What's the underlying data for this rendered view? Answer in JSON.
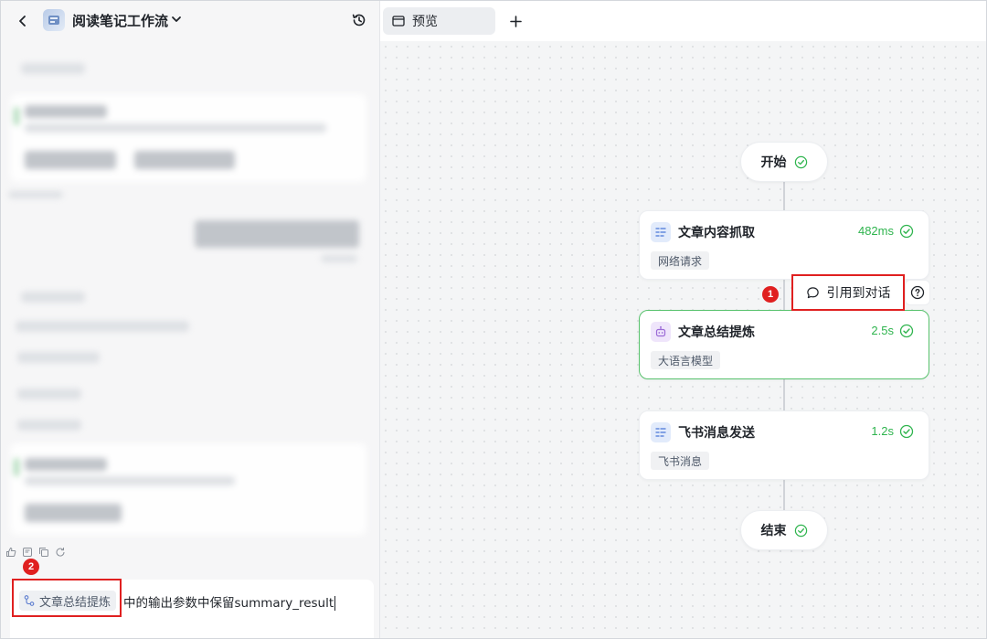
{
  "header": {
    "workflow_title": "阅读笔记工作流"
  },
  "tabs": {
    "preview_label": "预览"
  },
  "badges": {
    "first": "1",
    "second": "2"
  },
  "composer": {
    "chip_label": "文章总结提炼",
    "text": "中的输出参数中保留summary_result"
  },
  "workflow": {
    "start_label": "开始",
    "end_label": "结束",
    "nodes": [
      {
        "title": "文章内容抓取",
        "time": "482ms",
        "tag": "网络请求"
      },
      {
        "title": "文章总结提炼",
        "time": "2.5s",
        "tag": "大语言模型"
      },
      {
        "title": "飞书消息发送",
        "time": "1.2s",
        "tag": "飞书消息"
      }
    ],
    "cite_label": "引用到对话"
  },
  "colors": {
    "success": "#2fb44e",
    "highlight": "#e02020",
    "active_border": "#58c26d"
  }
}
